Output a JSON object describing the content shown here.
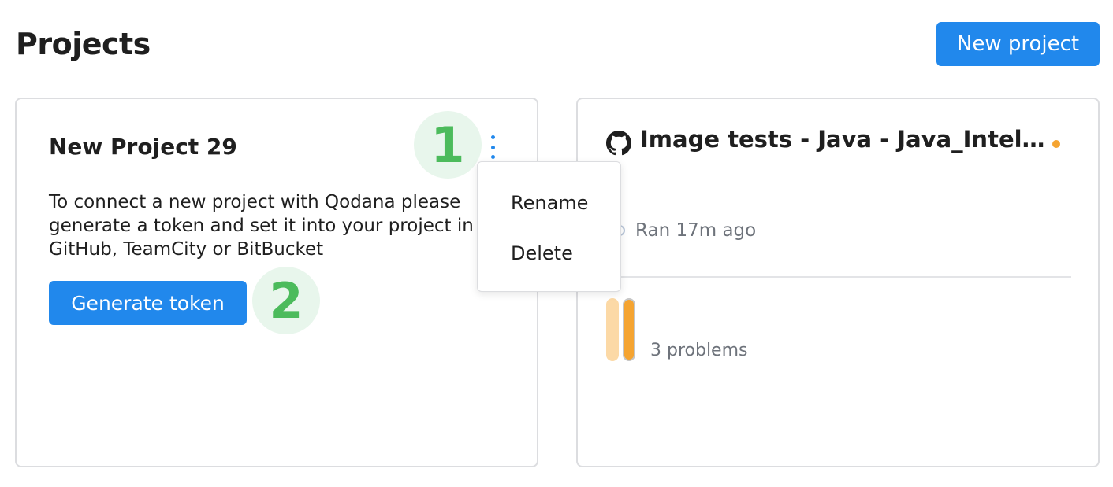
{
  "header": {
    "title": "Projects",
    "new_project_label": "New project"
  },
  "projects": [
    {
      "title": "New Project 29",
      "description": "To connect a new project with Qodana please generate a token and set it into your project in GitHub, TeamCity or BitBucket",
      "generate_token_label": "Generate token"
    },
    {
      "title": "Image tests - Java - Java_Intellij...",
      "ran": "Ran 17m ago",
      "problems": "3 problems",
      "status_color": "#f5a431",
      "icon": "github-icon"
    }
  ],
  "context_menu": {
    "items": [
      "Rename",
      "Delete"
    ]
  },
  "annotations": {
    "step_1": "1",
    "step_2": "2"
  },
  "colors": {
    "accent": "#2188ec",
    "badge_green": "#4cbb5c",
    "warning": "#f5a431"
  }
}
